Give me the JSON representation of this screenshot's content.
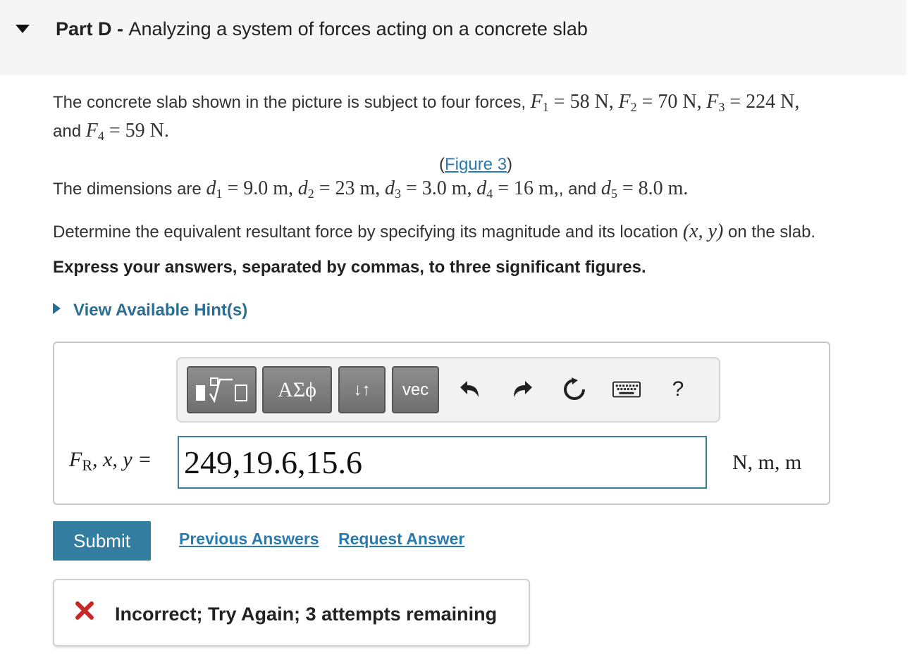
{
  "part": {
    "label": "Part D",
    "separator": " - ",
    "title": "Analyzing a system of forces acting on a concrete slab"
  },
  "problem": {
    "intro_text": "The concrete slab shown in the picture is subject to four forces, ",
    "F1": "= 58 N,",
    "F2": "= 70 N,",
    "F3": "= 224 N,",
    "and_text": "and ",
    "F4": "= 59 N.",
    "figure_open": "(",
    "figure_link": "Figure 3",
    "figure_close": ")",
    "dims_text": "The dimensions are ",
    "d1": "= 9.0 m,",
    "d2": "= 23 m,",
    "d3": "= 3.0 m,",
    "d4": "= 16 m,",
    "and2": ", and ",
    "d5": "= 8.0 m.",
    "determine_text": "Determine the equivalent resultant force by specifying its magnitude and its location ",
    "location_math": "(x, y)",
    "on_slab": " on the slab.",
    "express_text": "Express your answers, separated by commas, to three significant figures."
  },
  "hint": {
    "label": "View Available Hint(s)"
  },
  "toolbar": {
    "greek_label": "ΑΣϕ",
    "arrows_label": "↓↑",
    "vec_label": "vec",
    "help_label": "?"
  },
  "answer": {
    "lhs_sub": "R",
    "lhs_rest": ", x, y =",
    "value": "249,19.6,15.6",
    "units": "N, m, m"
  },
  "actions": {
    "submit_label": "Submit",
    "previous_answers_label": "Previous Answers",
    "request_answer_label": "Request Answer"
  },
  "feedback": {
    "message": "Incorrect; Try Again; 3 attempts remaining",
    "color": "#c62828"
  }
}
